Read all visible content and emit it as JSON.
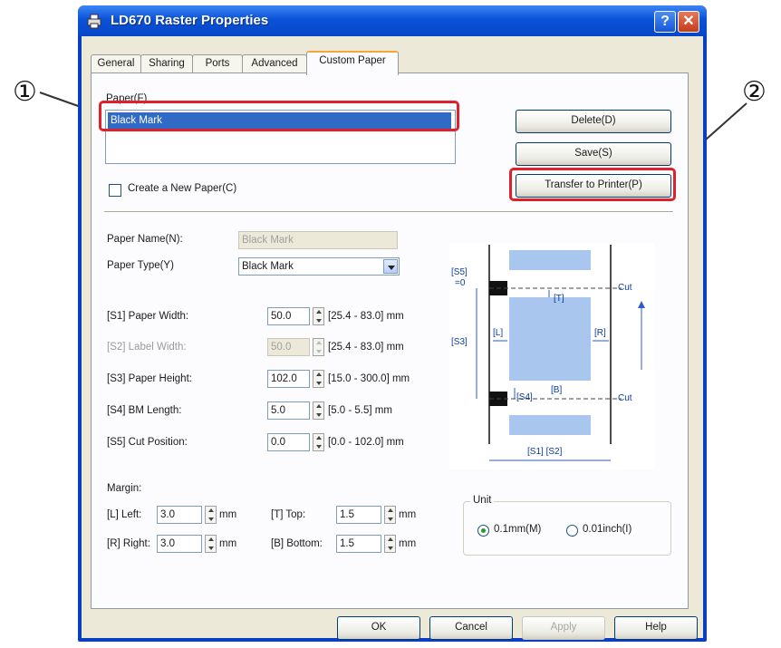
{
  "window": {
    "title": "LD670 Raster Properties",
    "help_glyph": "?",
    "close_glyph": "✕"
  },
  "tabs": [
    {
      "label": "General"
    },
    {
      "label": "Sharing"
    },
    {
      "label": "Ports"
    },
    {
      "label": "Advanced"
    },
    {
      "label": "Custom Paper",
      "active": true
    }
  ],
  "paper": {
    "label": "Paper(F)",
    "items": [
      "Black Mark"
    ],
    "selected": "Black Mark"
  },
  "buttons": {
    "delete": "Delete(D)",
    "save": "Save(S)",
    "transfer": "Transfer to Printer(P)",
    "ok": "OK",
    "cancel": "Cancel",
    "apply": "Apply",
    "help": "Help"
  },
  "create_new_paper": {
    "label": "Create a New Paper(C)",
    "checked": false
  },
  "form": {
    "paper_name": {
      "label": "Paper Name(N):",
      "value": "Black Mark"
    },
    "paper_type": {
      "label": "Paper Type(Y)",
      "value": "Black Mark"
    },
    "paper_width": {
      "label": "[S1] Paper Width:",
      "value": "50.0",
      "range": "[25.4 - 83.0] mm"
    },
    "label_width": {
      "label": "[S2] Label Width:",
      "value": "50.0",
      "range": "[25.4 - 83.0] mm"
    },
    "paper_height": {
      "label": "[S3] Paper Height:",
      "value": "102.0",
      "range": "[15.0 - 300.0] mm"
    },
    "bm_length": {
      "label": "[S4] BM Length:",
      "value": "5.0",
      "range": "[5.0 - 5.5] mm"
    },
    "cut_position": {
      "label": "[S5] Cut Position:",
      "value": "0.0",
      "range": "[0.0 - 102.0] mm"
    }
  },
  "margin": {
    "label": "Margin:",
    "left": {
      "label": "[L] Left:",
      "value": "3.0",
      "unit": "mm"
    },
    "right": {
      "label": "[R] Right:",
      "value": "3.0",
      "unit": "mm"
    },
    "top": {
      "label": "[T] Top:",
      "value": "1.5",
      "unit": "mm"
    },
    "bottom": {
      "label": "[B] Bottom:",
      "value": "1.5",
      "unit": "mm"
    }
  },
  "unit": {
    "label": "Unit",
    "options": [
      {
        "label": "0.1mm(M)",
        "selected": true
      },
      {
        "label": "0.01inch(I)",
        "selected": false
      }
    ]
  },
  "diagram": {
    "s5": "[S5]",
    "s5_eq": "=0",
    "cut_top": "Cut",
    "cut_bottom": "Cut",
    "t": "[T]",
    "l": "[L]",
    "r": "[R]",
    "s3": "[S3]",
    "s4": "[S4]",
    "b": "[B]",
    "s1s2": "[S1] [S2]"
  },
  "callouts": {
    "one": "①",
    "two": "②"
  },
  "colors": {
    "highlight": "#e0202a",
    "titlebar": "#0a52d8",
    "selection": "#316ac5"
  }
}
